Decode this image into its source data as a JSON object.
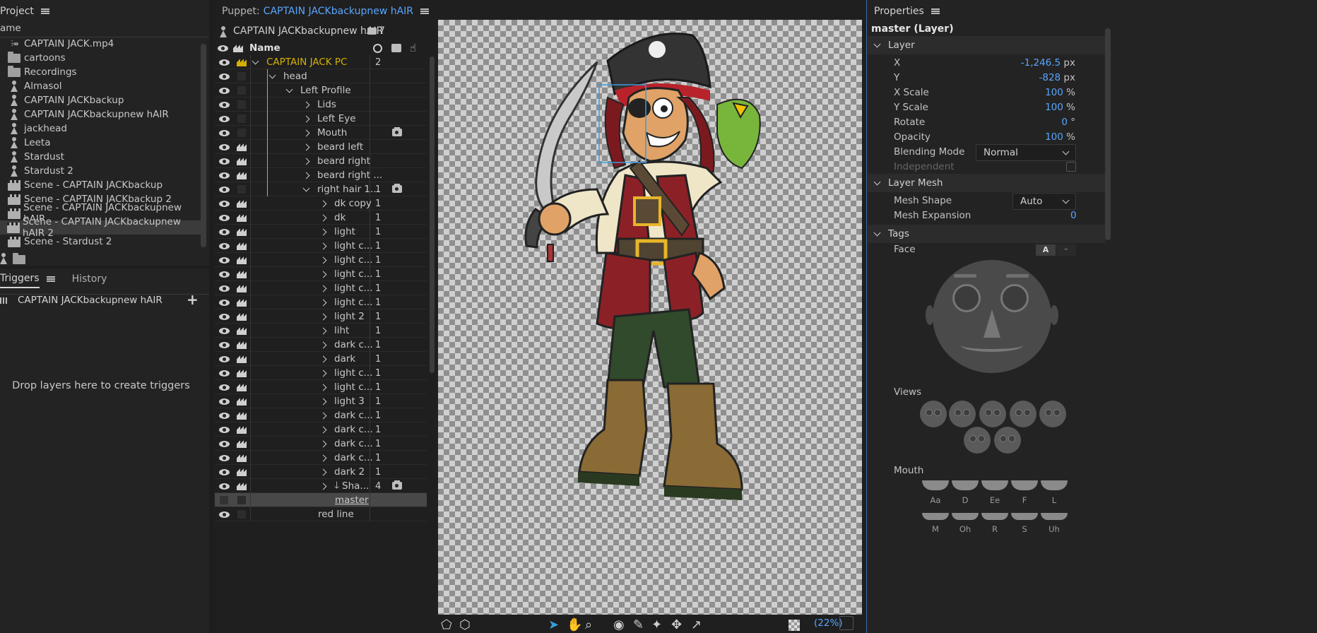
{
  "project": {
    "title": "Project",
    "column": "ame",
    "items": [
      {
        "icon": "audio-icon",
        "label": "CAPTAIN JACK.mp4"
      },
      {
        "icon": "folder-icon",
        "label": "cartoons"
      },
      {
        "icon": "folder-icon",
        "label": "Recordings"
      },
      {
        "icon": "puppet-icon",
        "label": "Almasol"
      },
      {
        "icon": "puppet-icon",
        "label": "CAPTAIN JACKbackup"
      },
      {
        "icon": "puppet-icon",
        "label": "CAPTAIN JACKbackupnew hAIR"
      },
      {
        "icon": "puppet-icon",
        "label": "jackhead"
      },
      {
        "icon": "puppet-icon",
        "label": "Leeta"
      },
      {
        "icon": "puppet-icon",
        "label": "Stardust"
      },
      {
        "icon": "puppet-icon",
        "label": "Stardust 2"
      },
      {
        "icon": "scene-icon",
        "label": "Scene - CAPTAIN JACKbackup"
      },
      {
        "icon": "scene-icon",
        "label": "Scene - CAPTAIN JACKbackup 2"
      },
      {
        "icon": "scene-icon",
        "label": "Scene - CAPTAIN JACKbackupnew hAIR"
      },
      {
        "icon": "scene-icon",
        "label": "Scene - CAPTAIN JACKbackupnew hAIR 2"
      },
      {
        "icon": "scene-icon",
        "label": "Scene - Stardust 2"
      }
    ]
  },
  "triggers": {
    "tab_triggers": "Triggers",
    "tab_history": "History",
    "puppet": "CAPTAIN JACKbackupnew hAIR",
    "plus": "+",
    "empty": "Drop layers here to create triggers"
  },
  "puppet": {
    "panel_prefix": "Puppet:",
    "panel_name": "CAPTAIN JACKbackupnew hAIR",
    "puppet_name": "CAPTAIN JACKbackupnew hAIR",
    "count": "7",
    "col_name": "Name",
    "rows": [
      {
        "name": "CAPTAIN JACK PC",
        "indent": 0,
        "chev": "open",
        "num": "2",
        "gold": true,
        "eye": true,
        "crown": true
      },
      {
        "name": "head",
        "indent": 1,
        "chev": "open",
        "num": "",
        "eye": true,
        "crown": false
      },
      {
        "name": "Left Profile",
        "indent": 2,
        "chev": "open",
        "num": "",
        "eye": true,
        "crown": false
      },
      {
        "name": "Lids",
        "indent": 3,
        "chev": "closed",
        "num": "",
        "eye": true,
        "crown": false
      },
      {
        "name": "Left Eye",
        "indent": 3,
        "chev": "closed",
        "num": "",
        "eye": true,
        "crown": false
      },
      {
        "name": "Mouth",
        "indent": 3,
        "chev": "closed",
        "num": "",
        "cam": true,
        "eye": true,
        "crown": false
      },
      {
        "name": "beard left",
        "indent": 3,
        "chev": "closed",
        "num": "",
        "eye": true,
        "crown": true
      },
      {
        "name": "beard right",
        "indent": 3,
        "chev": "closed",
        "num": "",
        "eye": true,
        "crown": true
      },
      {
        "name": "beard right ...",
        "indent": 3,
        "chev": "closed",
        "num": "",
        "eye": true,
        "crown": true
      },
      {
        "name": "right hair  1...",
        "indent": 3,
        "chev": "open",
        "num": "1",
        "cam": true,
        "eye": true,
        "crown": false
      },
      {
        "name": "dk copy",
        "indent": 4,
        "chev": "closed",
        "num": "1",
        "eye": true,
        "crown": true
      },
      {
        "name": "dk",
        "indent": 4,
        "chev": "closed",
        "num": "1",
        "eye": true,
        "crown": true
      },
      {
        "name": "light",
        "indent": 4,
        "chev": "closed",
        "num": "1",
        "eye": true,
        "crown": true
      },
      {
        "name": "light c...",
        "indent": 4,
        "chev": "closed",
        "num": "1",
        "eye": true,
        "crown": true
      },
      {
        "name": "light c...",
        "indent": 4,
        "chev": "closed",
        "num": "1",
        "eye": true,
        "crown": true
      },
      {
        "name": "light c...",
        "indent": 4,
        "chev": "closed",
        "num": "1",
        "eye": true,
        "crown": true
      },
      {
        "name": "light c...",
        "indent": 4,
        "chev": "closed",
        "num": "1",
        "eye": true,
        "crown": true
      },
      {
        "name": "light c...",
        "indent": 4,
        "chev": "closed",
        "num": "1",
        "eye": true,
        "crown": true
      },
      {
        "name": "light 2",
        "indent": 4,
        "chev": "closed",
        "num": "1",
        "eye": true,
        "crown": true
      },
      {
        "name": "liht",
        "indent": 4,
        "chev": "closed",
        "num": "1",
        "eye": true,
        "crown": true
      },
      {
        "name": "dark c...",
        "indent": 4,
        "chev": "closed",
        "num": "1",
        "eye": true,
        "crown": true
      },
      {
        "name": "dark",
        "indent": 4,
        "chev": "closed",
        "num": "1",
        "eye": true,
        "crown": true
      },
      {
        "name": "light c...",
        "indent": 4,
        "chev": "closed",
        "num": "1",
        "eye": true,
        "crown": true
      },
      {
        "name": "light c...",
        "indent": 4,
        "chev": "closed",
        "num": "1",
        "eye": true,
        "crown": true
      },
      {
        "name": "light 3",
        "indent": 4,
        "chev": "closed",
        "num": "1",
        "eye": true,
        "crown": true
      },
      {
        "name": "dark c...",
        "indent": 4,
        "chev": "closed",
        "num": "1",
        "eye": true,
        "crown": true
      },
      {
        "name": "dark c...",
        "indent": 4,
        "chev": "closed",
        "num": "1",
        "eye": true,
        "crown": true
      },
      {
        "name": "dark c...",
        "indent": 4,
        "chev": "closed",
        "num": "1",
        "eye": true,
        "crown": true
      },
      {
        "name": "dark c...",
        "indent": 4,
        "chev": "closed",
        "num": "1",
        "eye": true,
        "crown": true
      },
      {
        "name": "dark 2",
        "indent": 4,
        "chev": "closed",
        "num": "1",
        "eye": true,
        "crown": true
      },
      {
        "name": "Sha...",
        "indent": 4,
        "chev": "closed",
        "num": "4",
        "cam": true,
        "eye": true,
        "crown": true,
        "arrow": true
      },
      {
        "name": "master",
        "indent": 4,
        "chev": "none",
        "num": "",
        "eye": false,
        "crown": false,
        "selected": true
      },
      {
        "name": "red line",
        "indent": 3,
        "chev": "none",
        "num": "",
        "eye": true,
        "crown": false
      }
    ]
  },
  "viewer": {
    "zoom": "(22%)"
  },
  "properties": {
    "title": "Properties",
    "object": "master (Layer)",
    "layer_section": "Layer",
    "fields": [
      {
        "label": "X",
        "value": "-1,246.5",
        "unit": " px"
      },
      {
        "label": "Y",
        "value": "-828",
        "unit": " px"
      },
      {
        "label": "X Scale",
        "value": "100",
        "unit": " %"
      },
      {
        "label": "Y Scale",
        "value": "100",
        "unit": " %"
      },
      {
        "label": "Rotate",
        "value": "0",
        "unit": " °"
      },
      {
        "label": "Opacity",
        "value": "100",
        "unit": " %"
      }
    ],
    "blending_label": "Blending Mode",
    "blending_value": "Normal",
    "independent_label": "Independent",
    "mesh_section": "Layer Mesh",
    "mesh_shape_label": "Mesh Shape",
    "mesh_shape_value": "Auto",
    "mesh_expansion_label": "Mesh Expansion",
    "mesh_expansion_value": "0",
    "tags_section": "Tags",
    "face_label": "Face",
    "face_btn_a": "A",
    "views_label": "Views",
    "mouth_label": "Mouth",
    "mouth_shapes": [
      "Aa",
      "D",
      "Ee",
      "F",
      "L"
    ],
    "mouth_shapes2": [
      "M",
      "Oh",
      "R",
      "S",
      "Uh"
    ]
  },
  "colors": {
    "accent": "#58a6ff",
    "gold": "#d4b100"
  }
}
